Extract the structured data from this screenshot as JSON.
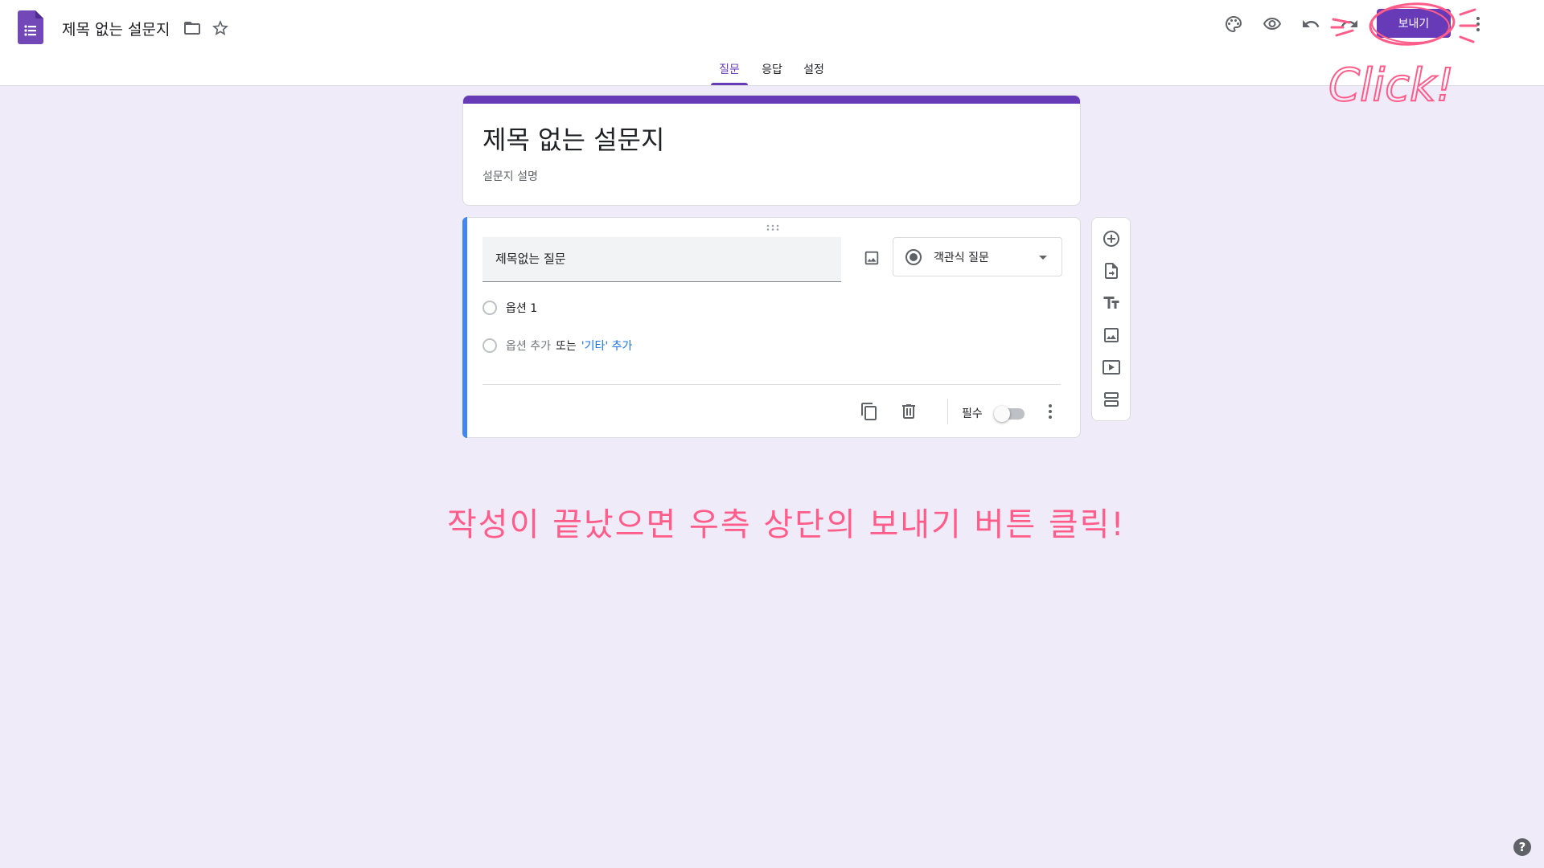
{
  "header": {
    "doc_title": "제목 없는 설문지",
    "send_label": "보내기",
    "icons": [
      "folder-icon",
      "star-icon",
      "palette-icon",
      "eye-icon",
      "undo-icon",
      "redo-icon",
      "more-vert-icon"
    ]
  },
  "tabs": [
    {
      "label": "질문",
      "active": true
    },
    {
      "label": "응답",
      "active": false
    },
    {
      "label": "설정",
      "active": false
    }
  ],
  "form": {
    "title": "제목 없는 설문지",
    "description": "설문지 설명"
  },
  "question": {
    "title": "제목없는 질문",
    "type": "객관식 질문",
    "options": [
      "옵션 1"
    ],
    "add_option_prefix": "옵션 추가",
    "add_option_or": "또는",
    "add_other_link": "'기타' 추가",
    "required_label": "필수",
    "required": false
  },
  "annotation": {
    "instruction": "작성이 끝났으면 우측 상단의 보내기 버튼 클릭!",
    "click_text": "Click!"
  },
  "help": "?",
  "colors": {
    "accent": "#673ab7",
    "background": "#f0ebf8",
    "question_accent": "#4285f4",
    "annotation": "#ff5c8a"
  }
}
